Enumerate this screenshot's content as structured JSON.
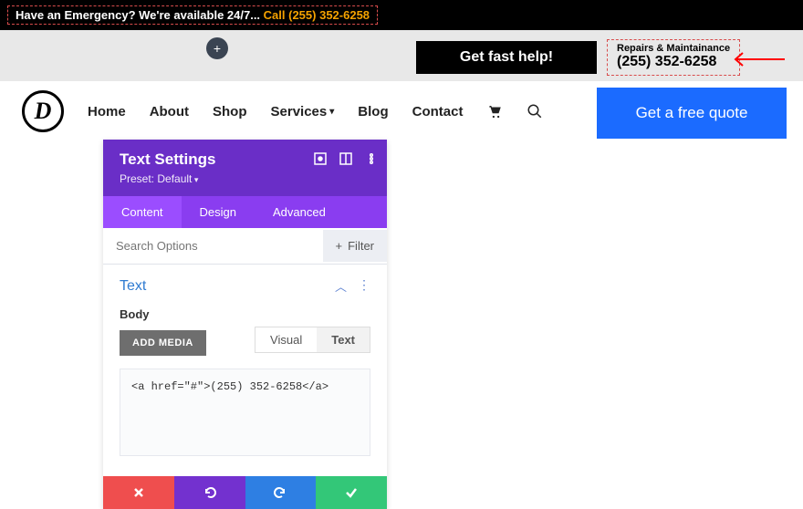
{
  "topbar": {
    "emergency_text": "Have an Emergency? We're available 24/7... ",
    "call_text": "Call (255) 352-6258"
  },
  "grayband": {
    "fast_help": "Get fast help!",
    "repairs_line1": "Repairs & Maintainance",
    "repairs_line2": "(255) 352-6258"
  },
  "nav": {
    "items": [
      "Home",
      "About",
      "Shop",
      "Services",
      "Blog",
      "Contact"
    ]
  },
  "quote_btn": "Get a free quote",
  "panel": {
    "title": "Text Settings",
    "preset": "Preset: Default",
    "tabs": [
      "Content",
      "Design",
      "Advanced"
    ],
    "search_placeholder": "Search Options",
    "filter_label": "Filter",
    "section_title": "Text",
    "body_label": "Body",
    "add_media": "ADD MEDIA",
    "editor_tabs": [
      "Visual",
      "Text"
    ],
    "editor_content": "<a href=\"#\">(255) 352-6258</a>"
  }
}
